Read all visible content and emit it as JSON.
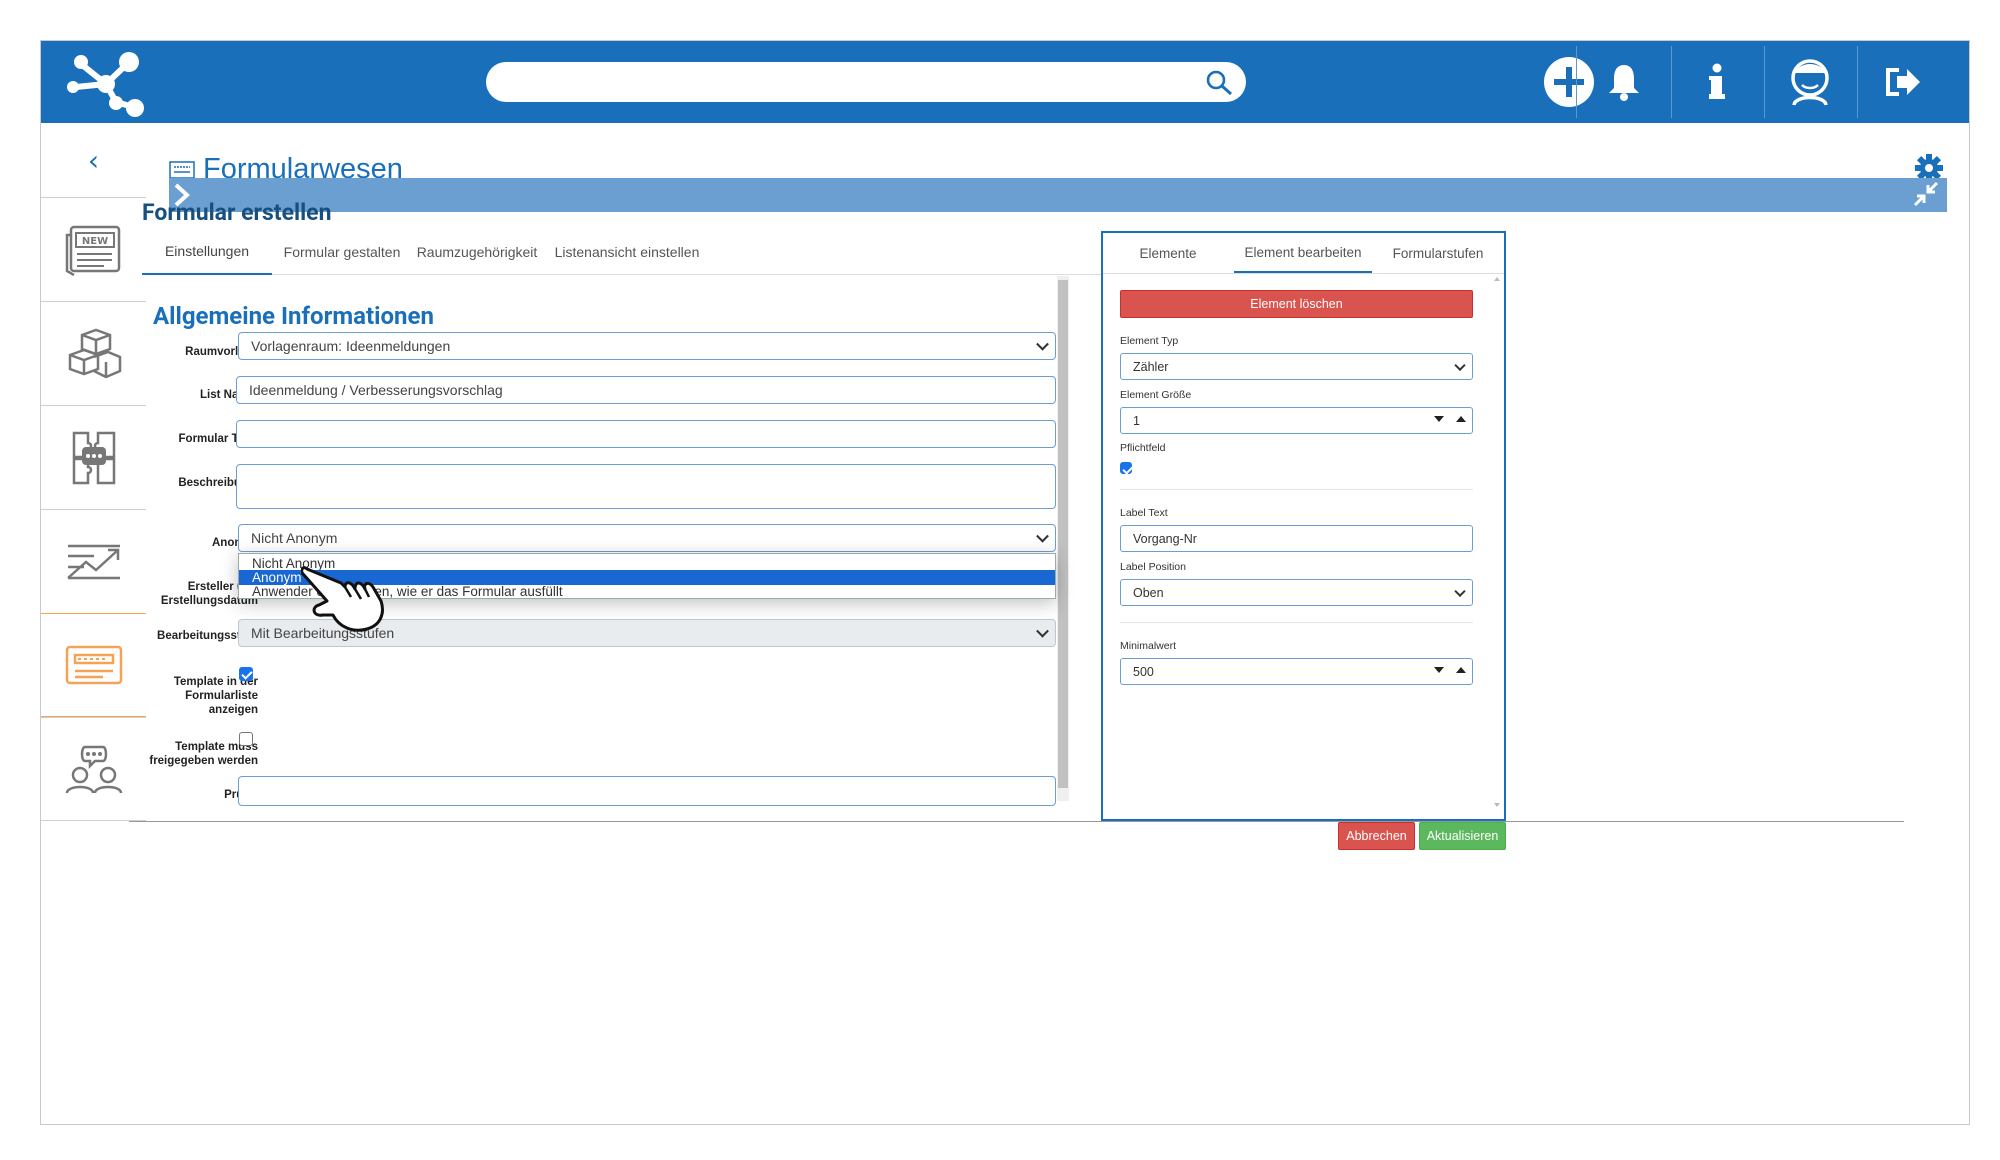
{
  "colors": {
    "primary": "#1a6fbb",
    "danger": "#d9534f",
    "success": "#5cb85c",
    "accent_orange": "#f3a257"
  },
  "topbar": {
    "icons": [
      "logo-network-icon",
      "search-icon",
      "add-circle-icon",
      "bell-icon",
      "info-icon",
      "avatar-icon",
      "logout-icon"
    ],
    "search": {
      "placeholder": "",
      "value": ""
    }
  },
  "sidebar": {
    "back": "‹",
    "items": [
      {
        "icon": "news-icon"
      },
      {
        "icon": "boxes-icon"
      },
      {
        "icon": "knowledge-icon"
      },
      {
        "icon": "chart-icon"
      },
      {
        "icon": "form-icon",
        "active": true
      },
      {
        "icon": "people-chat-icon"
      }
    ]
  },
  "page": {
    "title": "Formularwesen"
  },
  "form": {
    "title": "Formular erstellen",
    "tabs": [
      "Einstellungen",
      "Formular gestalten",
      "Raumzugehörigkeit",
      "Listenansicht einstellen"
    ],
    "active_tab": "Einstellungen",
    "section_title": "Allgemeine Informationen",
    "fields": {
      "raumvorlage": {
        "label": "Raumvorlage",
        "value": "Vorlagenraum: Ideenmeldungen"
      },
      "list_name": {
        "label": "List Name",
        "value": "Ideenmeldung / Verbesserungsvorschlag"
      },
      "formular_titel": {
        "label": "Formular Titel",
        "value": ""
      },
      "beschreibung": {
        "label": "Beschreibung",
        "value": ""
      },
      "anonym": {
        "label": "Anonym",
        "value": "Nicht Anonym"
      },
      "ersteller": {
        "label_line1": "Ersteller und",
        "label_line2": "Erstellungsdatum"
      },
      "bearbeitungsstufe": {
        "label": "Bearbeitungsstufe",
        "value": "Mit Bearbeitungsstufen"
      },
      "template_liste": {
        "label_line1": "Template in der",
        "label_line2": "Formularliste",
        "label_line3": "anzeigen",
        "checked": true
      },
      "template_freigabe": {
        "label_line1": "Template muss",
        "label_line2": "freigegeben werden",
        "checked": false
      },
      "pruefer": {
        "label": "Prüfer",
        "value": ""
      }
    },
    "anonym_options": [
      "Nicht Anonym",
      "Anonym",
      "Anwender entscheiden, wie er das Formular ausfüllt"
    ],
    "anonym_highlighted": "Anonym"
  },
  "right_panel": {
    "tabs": [
      "Elemente",
      "Element bearbeiten",
      "Formularstufen"
    ],
    "active_tab": "Element bearbeiten",
    "delete_label": "Element löschen",
    "element_typ": {
      "label": "Element Typ",
      "value": "Zähler"
    },
    "element_groesse": {
      "label": "Element Größe",
      "value": "1"
    },
    "pflichtfeld": {
      "label": "Pflichtfeld",
      "checked": true
    },
    "label_text": {
      "label": "Label Text",
      "value": "Vorgang-Nr"
    },
    "label_position": {
      "label": "Label Position",
      "value": "Oben"
    },
    "minimalwert": {
      "label": "Minimalwert",
      "value": "500"
    }
  },
  "footer": {
    "cancel_label": "Abbrechen",
    "update_label": "Aktualisieren"
  }
}
